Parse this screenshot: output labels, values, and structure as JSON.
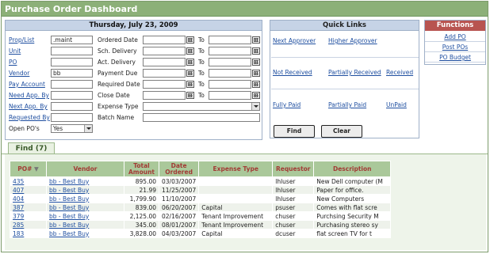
{
  "app": {
    "title": "Purchase Order Dashboard"
  },
  "date_panel": {
    "date": "Thursday, July 23, 2009",
    "left_fields": [
      {
        "label": "Prop/List",
        "value": ".maint",
        "is_link": true
      },
      {
        "label": "Unit",
        "value": "",
        "is_link": true
      },
      {
        "label": "PO",
        "value": "",
        "is_link": true
      },
      {
        "label": "Vendor",
        "value": "bb",
        "is_link": true
      },
      {
        "label": "Pay Account",
        "value": "",
        "is_link": true
      },
      {
        "label": "Need App. By",
        "value": "",
        "is_link": true
      },
      {
        "label": "Next App. By",
        "value": "",
        "is_link": true
      },
      {
        "label": "Requested By",
        "value": "",
        "is_link": true
      },
      {
        "label": "Open PO's",
        "value": "Yes",
        "is_link": false
      }
    ],
    "date_fields": [
      {
        "label": "Ordered Date",
        "to": "To"
      },
      {
        "label": "Sch. Delivery",
        "to": "To"
      },
      {
        "label": "Act. Delivery",
        "to": "To"
      },
      {
        "label": "Payment Due",
        "to": "To"
      },
      {
        "label": "Required Date",
        "to": "To"
      },
      {
        "label": "Close Date",
        "to": "To"
      }
    ],
    "expense_type_label": "Expense Type",
    "expense_type_value": "",
    "batch_name_label": "Batch Name",
    "batch_name_value": ""
  },
  "quick_links": {
    "header": "Quick Links",
    "row1": [
      "Next Approver",
      "Higher Approver"
    ],
    "row2": [
      "Not Received",
      "Partially Received",
      "Received"
    ],
    "row3": [
      "Fully Paid",
      "Partially Paid",
      "UnPaid"
    ],
    "find_label": "Find",
    "clear_label": "Clear"
  },
  "functions": {
    "header": "Functions",
    "items": [
      "Add PO",
      "Post POs",
      "PO Budget"
    ]
  },
  "results_tab": {
    "label": "Find (7)"
  },
  "table": {
    "headers": {
      "po": "PO#",
      "vendor": "Vendor",
      "total1": "Total",
      "total2": "Amount",
      "date1": "Date",
      "date2": "Ordered",
      "expense": "Expense Type",
      "requestor": "Requestor",
      "description": "Description"
    },
    "rows": [
      {
        "po": "435",
        "vendor": "bb - Best Buy",
        "amount": "895.00",
        "date": "03/03/2007",
        "expense": "",
        "requestor": "lhluser",
        "description": "New Dell computer (M"
      },
      {
        "po": "407",
        "vendor": "bb - Best Buy",
        "amount": "21.99",
        "date": "11/25/2007",
        "expense": "",
        "requestor": "lhluser",
        "description": "Paper for office."
      },
      {
        "po": "404",
        "vendor": "bb - Best Buy",
        "amount": "1,799.90",
        "date": "11/10/2007",
        "expense": "",
        "requestor": "lhluser",
        "description": "New Computers"
      },
      {
        "po": "387",
        "vendor": "bb - Best Buy",
        "amount": "839.00",
        "date": "06/20/2007",
        "expense": "Capital",
        "requestor": "psuser",
        "description": "Comes with flat scre"
      },
      {
        "po": "379",
        "vendor": "bb - Best Buy",
        "amount": "2,125.00",
        "date": "02/16/2007",
        "expense": "Tenant Improvement",
        "requestor": "chuser",
        "description": "Purchsing Security M"
      },
      {
        "po": "285",
        "vendor": "bb - Best Buy",
        "amount": "345.00",
        "date": "08/01/2007",
        "expense": "Tenant Improvement",
        "requestor": "chuser",
        "description": "Purchasing stereo sy"
      },
      {
        "po": "183",
        "vendor": "bb - Best Buy",
        "amount": "3,828.00",
        "date": "04/03/2007",
        "expense": "Capital",
        "requestor": "dcuser",
        "description": "flat screen TV for t"
      }
    ]
  }
}
